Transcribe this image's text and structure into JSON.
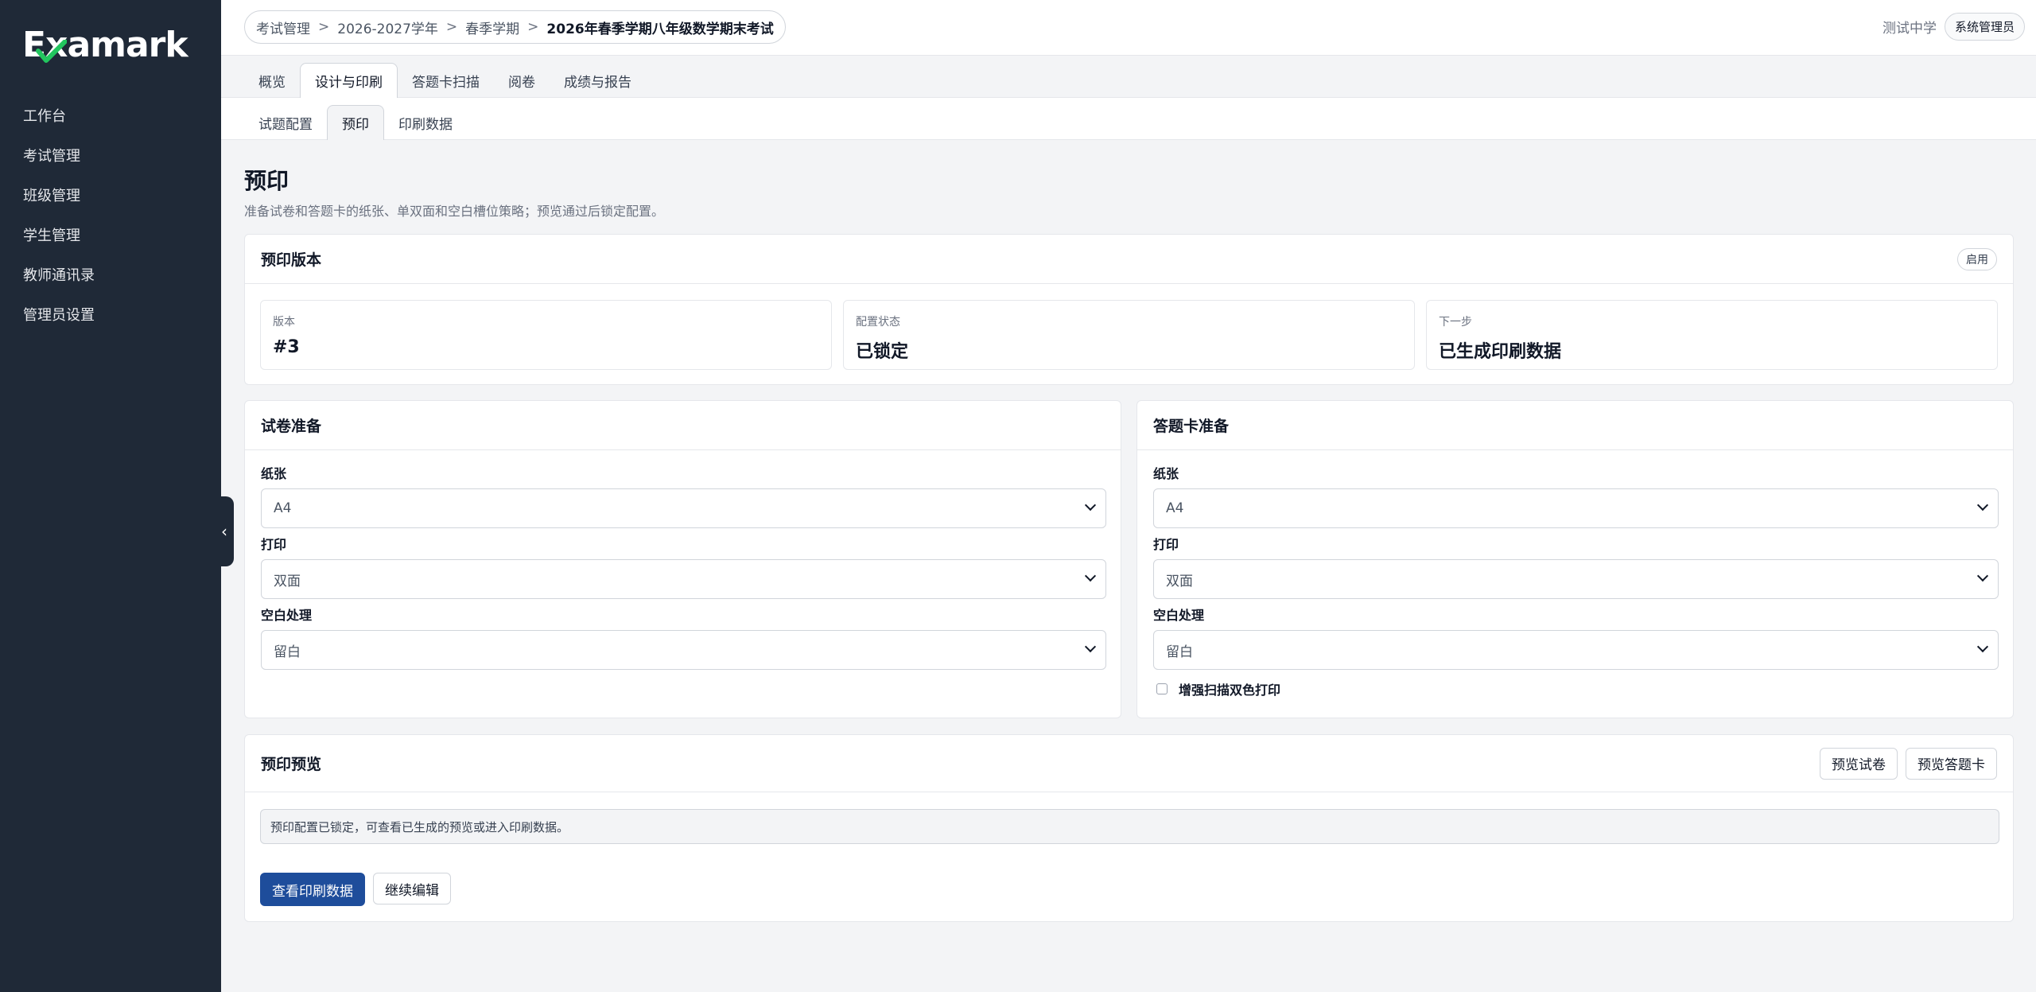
{
  "brand": {
    "name": "Examark",
    "check_color": "#22c55e"
  },
  "sidebar": {
    "items": [
      {
        "label": "工作台"
      },
      {
        "label": "考试管理"
      },
      {
        "label": "班级管理"
      },
      {
        "label": "学生管理"
      },
      {
        "label": "教师通讯录"
      },
      {
        "label": "管理员设置"
      }
    ],
    "collapse_icon": "‹"
  },
  "header": {
    "breadcrumb": [
      "考试管理",
      "2026-2027学年",
      "春季学期",
      "2026年春季学期八年级数学期末考试"
    ],
    "separator": ">",
    "school": "测试中学",
    "role": "系统管理员"
  },
  "tabs": [
    {
      "label": "概览"
    },
    {
      "label": "设计与印刷"
    },
    {
      "label": "答题卡扫描"
    },
    {
      "label": "阅卷"
    },
    {
      "label": "成绩与报告"
    }
  ],
  "subtabs": [
    {
      "label": "试题配置"
    },
    {
      "label": "预印"
    },
    {
      "label": "印刷数据"
    }
  ],
  "page": {
    "title": "预印",
    "description": "准备试卷和答题卡的纸张、单双面和空白槽位策略；预览通过后锁定配置。"
  },
  "version_card": {
    "title": "预印版本",
    "status": "启用",
    "stats": [
      {
        "label": "版本",
        "value": "#3"
      },
      {
        "label": "配置状态",
        "value": "已锁定"
      },
      {
        "label": "下一步",
        "value": "已生成印刷数据"
      }
    ]
  },
  "paper_prep": {
    "title": "试卷准备",
    "fields": [
      {
        "label": "纸张",
        "value": "A4"
      },
      {
        "label": "打印",
        "value": "双面"
      },
      {
        "label": "空白处理",
        "value": "留白"
      }
    ]
  },
  "card_prep": {
    "title": "答题卡准备",
    "fields": [
      {
        "label": "纸张",
        "value": "A4"
      },
      {
        "label": "打印",
        "value": "双面"
      },
      {
        "label": "空白处理",
        "value": "留白"
      }
    ],
    "checkbox_label": "增强扫描双色打印"
  },
  "preview": {
    "title": "预印预览",
    "preview_paper_label": "预览试卷",
    "preview_card_label": "预览答题卡",
    "notice": "预印配置已锁定，可查看已生成的预览或进入印刷数据。",
    "view_data_label": "查看印刷数据",
    "continue_edit_label": "继续编辑",
    "primary_color": "#1e4d9b"
  }
}
